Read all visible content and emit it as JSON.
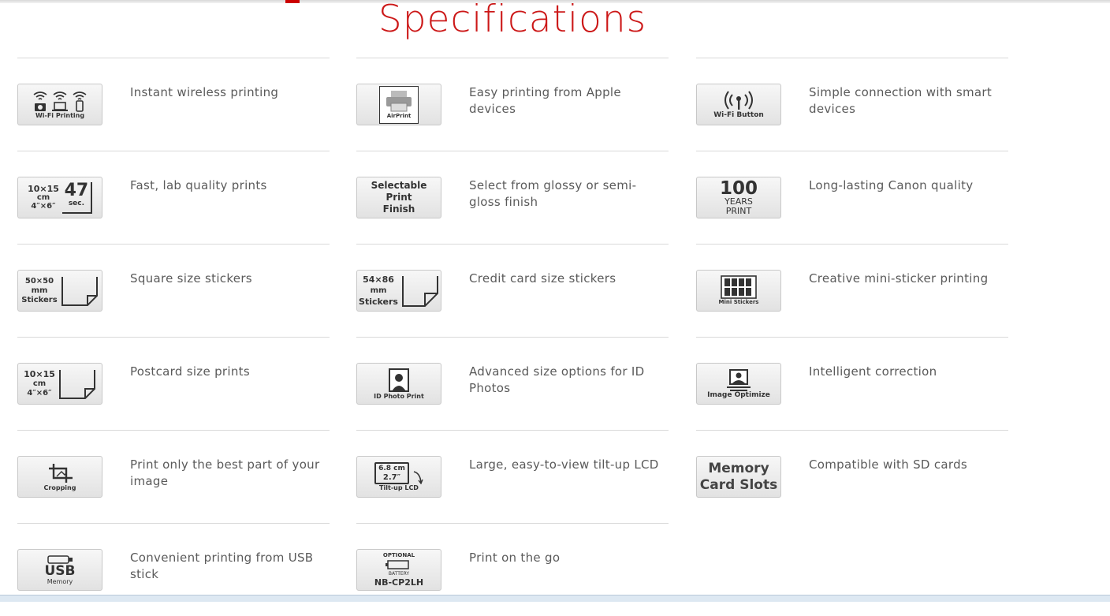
{
  "title": "Specifications",
  "columns": [
    {
      "items": [
        {
          "text": "Instant wireless printing",
          "icon": "wifi-printing-icon",
          "icon_caption": "Wi-Fi Printing"
        },
        {
          "text": "Fast, lab quality prints",
          "icon": "print-speed-icon",
          "icon_caption": "10×15 cm 4″×6″ 47 sec."
        },
        {
          "text": "Square size stickers",
          "icon": "square-sticker-icon",
          "icon_caption": "50×50 mm Stickers"
        },
        {
          "text": "Postcard size prints",
          "icon": "postcard-icon",
          "icon_caption": "10×15 cm 4″×6″"
        },
        {
          "text": "Print only the best part of your image",
          "icon": "cropping-icon",
          "icon_caption": "Cropping"
        },
        {
          "text": "Convenient printing from USB stick",
          "icon": "usb-memory-icon",
          "icon_caption": "USB Memory"
        }
      ]
    },
    {
      "items": [
        {
          "text": "Easy printing from Apple devices",
          "icon": "airprint-icon",
          "icon_caption": "AirPrint"
        },
        {
          "text": "Select from glossy or semi-gloss finish",
          "icon": "print-finish-icon",
          "icon_caption": "Selectable Print Finish"
        },
        {
          "text": "Credit card size stickers",
          "icon": "credit-card-sticker-icon",
          "icon_caption": "54×86 mm Stickers"
        },
        {
          "text": "Advanced size options for ID Photos",
          "icon": "id-photo-icon",
          "icon_caption": "ID Photo Print"
        },
        {
          "text": "Large, easy-to-view tilt-up LCD",
          "icon": "tilt-lcd-icon",
          "icon_caption": "6.8 cm 2.7″ Tilt-up LCD"
        },
        {
          "text": "Print on the go",
          "icon": "battery-icon",
          "icon_caption": "OPTIONAL BATTERY NB-CP2LH"
        }
      ]
    },
    {
      "items": [
        {
          "text": "Simple connection with smart devices",
          "icon": "wifi-button-icon",
          "icon_caption": "Wi-Fi Button"
        },
        {
          "text": "Long-lasting Canon quality",
          "icon": "100-years-icon",
          "icon_caption": "100 YEARS PRINT"
        },
        {
          "text": "Creative mini-sticker printing",
          "icon": "mini-stickers-icon",
          "icon_caption": "Mini Stickers"
        },
        {
          "text": "Intelligent correction",
          "icon": "image-optimize-icon",
          "icon_caption": "Image Optimize"
        },
        {
          "text": "Compatible with SD cards",
          "icon": "memory-card-icon",
          "icon_caption": "Memory Card Slots"
        }
      ]
    }
  ],
  "icon_text": {
    "c1_0": "Wi-Fi Printing",
    "c1_1a": "10×15",
    "c1_1b": "cm",
    "c1_1c": "4″×6″",
    "c1_1d": "47",
    "c1_1e": "sec.",
    "c1_2a": "50×50",
    "c1_2b": "mm",
    "c1_2c": "Stickers",
    "c1_3a": "10×15",
    "c1_3b": "cm",
    "c1_3c": "4″×6″",
    "c1_4": "Cropping",
    "c1_5a": "USB",
    "c1_5b": "Memory",
    "c2_0": "AirPrint",
    "c2_1a": "Selectable",
    "c2_1b": "Print",
    "c2_1c": "Finish",
    "c2_2a": "54×86",
    "c2_2b": "mm",
    "c2_2c": "Stickers",
    "c2_3": "ID Photo Print",
    "c2_4a": "6.8 cm",
    "c2_4b": "2.7″",
    "c2_4c": "Tilt-up LCD",
    "c2_5a": "OPTIONAL",
    "c2_5b": "BATTERY",
    "c2_5c": "NB-CP2LH",
    "c3_0": "Wi-Fi Button",
    "c3_1a": "100",
    "c3_1b": "YEARS",
    "c3_1c": "PRINT",
    "c3_2": "Mini Stickers",
    "c3_3": "Image Optimize",
    "c3_4a": "Memory",
    "c3_4b": "Card Slots"
  },
  "colors": {
    "title": "#cc1818",
    "text": "#5a5a5a",
    "divider": "#d9d9d9",
    "accent": "#c00000"
  }
}
